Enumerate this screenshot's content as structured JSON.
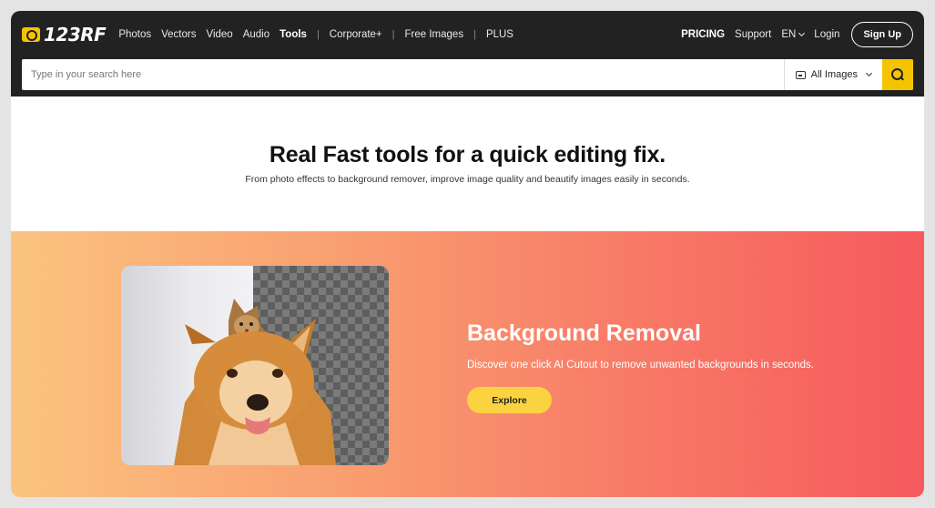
{
  "brand": {
    "name": "123RF"
  },
  "nav": {
    "links": [
      {
        "label": "Photos"
      },
      {
        "label": "Vectors"
      },
      {
        "label": "Video"
      },
      {
        "label": "Audio"
      },
      {
        "label": "Tools"
      }
    ],
    "sep": "|",
    "secondary": [
      {
        "label": "Corporate+"
      },
      {
        "label": "Free Images"
      },
      {
        "label": "PLUS"
      }
    ],
    "right": {
      "pricing": "PRICING",
      "support": "Support",
      "language": "EN",
      "login": "Login",
      "signup": "Sign Up"
    }
  },
  "search": {
    "placeholder": "Type in your search here",
    "value": "",
    "type_selected": "All Images"
  },
  "hero": {
    "title": "Real Fast tools for a quick editing fix.",
    "subtitle": "From photo effects to background remover, improve image quality and beautify images easily in seconds."
  },
  "feature": {
    "title": "Background Removal",
    "description": "Discover one click AI Cutout to remove unwanted backgrounds in seconds.",
    "cta": "Explore"
  },
  "colors": {
    "nav_bg": "#222222",
    "accent_yellow": "#f5c400",
    "button_yellow": "#fbd341",
    "gradient_start": "#fbc37f",
    "gradient_end": "#f65a5d"
  },
  "icons": [
    "logo-icon",
    "image-icon",
    "chevron-down-icon",
    "search-icon"
  ]
}
